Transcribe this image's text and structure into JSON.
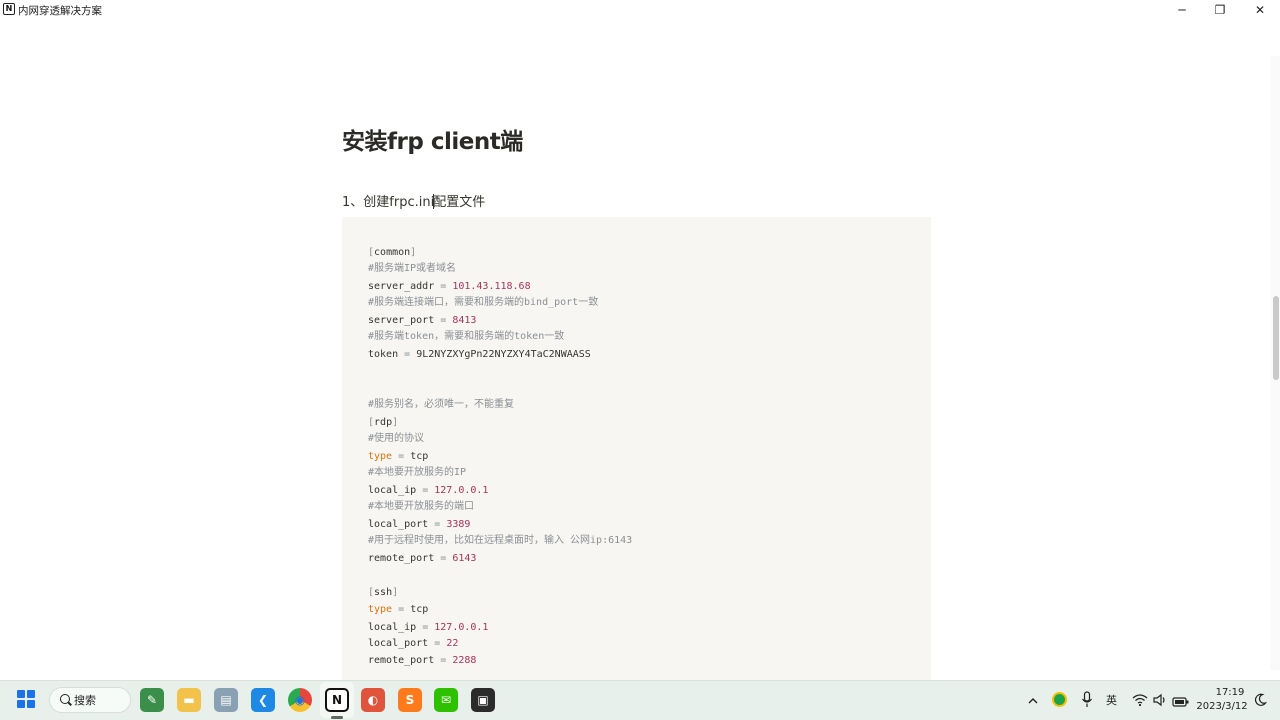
{
  "window": {
    "title": "内网穿透解决方案",
    "app_icon_letter": "N",
    "minimize_glyph": "─",
    "maximize_glyph": "❐",
    "close_glyph": "✕"
  },
  "page": {
    "heading": "安装frp client端",
    "step_text_before_caret": "1、创建frpc.ini",
    "step_text_after_caret": "配置文件"
  },
  "code": {
    "lines": [
      {
        "type": "section",
        "name": "common"
      },
      {
        "type": "comment",
        "text": "#服务端IP或者域名"
      },
      {
        "type": "kv",
        "key": "server_addr",
        "value": "101.43.118.68",
        "value_style": "num"
      },
      {
        "type": "comment",
        "text": "#服务端连接端口，需要和服务端的bind_port一致"
      },
      {
        "type": "kv",
        "key": "server_port",
        "value": "8413",
        "value_style": "num"
      },
      {
        "type": "comment",
        "text": "#服务端token，需要和服务端的token一致"
      },
      {
        "type": "kv",
        "key": "token",
        "value": "9L2NYZXYgPn22NYZXY4TaC2NWAASS",
        "value_style": "plain"
      },
      {
        "type": "blank"
      },
      {
        "type": "blank"
      },
      {
        "type": "comment",
        "text": "#服务别名，必须唯一，不能重复"
      },
      {
        "type": "section",
        "name": "rdp"
      },
      {
        "type": "comment",
        "text": "#使用的协议"
      },
      {
        "type": "kv",
        "key": "type",
        "value": "tcp",
        "value_style": "plain",
        "key_style": "kw"
      },
      {
        "type": "comment",
        "text": "#本地要开放服务的IP"
      },
      {
        "type": "kv",
        "key": "local_ip",
        "value": "127.0.0.1",
        "value_style": "num"
      },
      {
        "type": "comment",
        "text": "#本地要开放服务的端口"
      },
      {
        "type": "kv",
        "key": "local_port",
        "value": "3389",
        "value_style": "num"
      },
      {
        "type": "comment",
        "text": "#用于远程时使用，比如在远程桌面时，输入 公网ip:6143"
      },
      {
        "type": "kv",
        "key": "remote_port",
        "value": "6143",
        "value_style": "num"
      },
      {
        "type": "blank"
      },
      {
        "type": "section",
        "name": "ssh"
      },
      {
        "type": "kv",
        "key": "type",
        "value": "tcp",
        "value_style": "plain",
        "key_style": "kw"
      },
      {
        "type": "kv",
        "key": "local_ip",
        "value": "127.0.0.1",
        "value_style": "num"
      },
      {
        "type": "kv",
        "key": "local_port",
        "value": "22",
        "value_style": "num"
      },
      {
        "type": "kv",
        "key": "remote_port",
        "value": "2288",
        "value_style": "num"
      }
    ],
    "eq": "=",
    "open_bracket": "[",
    "close_bracket": "]"
  },
  "taskbar": {
    "search_label": "搜索",
    "apps": [
      {
        "name": "start-menu-icon"
      },
      {
        "name": "excel-like-icon",
        "color": "#3c8f4b"
      },
      {
        "name": "file-explorer-icon",
        "color": "#f2c24b"
      },
      {
        "name": "notepad-icon",
        "color": "#8aa0b3"
      },
      {
        "name": "vscode-icon",
        "color": "#1e88e5"
      },
      {
        "name": "chrome-icon",
        "color": "#e8453c"
      },
      {
        "name": "notion-icon",
        "color": "#111111"
      },
      {
        "name": "browser-icon",
        "color": "#e0543c"
      },
      {
        "name": "sublime-icon",
        "color": "#ff7a1a"
      },
      {
        "name": "wechat-icon",
        "color": "#2dc100"
      },
      {
        "name": "terminal-icon",
        "color": "#2b2b2b"
      }
    ],
    "tray": {
      "ime_label": "英",
      "time": "17:19",
      "date": "2023/3/12"
    }
  }
}
